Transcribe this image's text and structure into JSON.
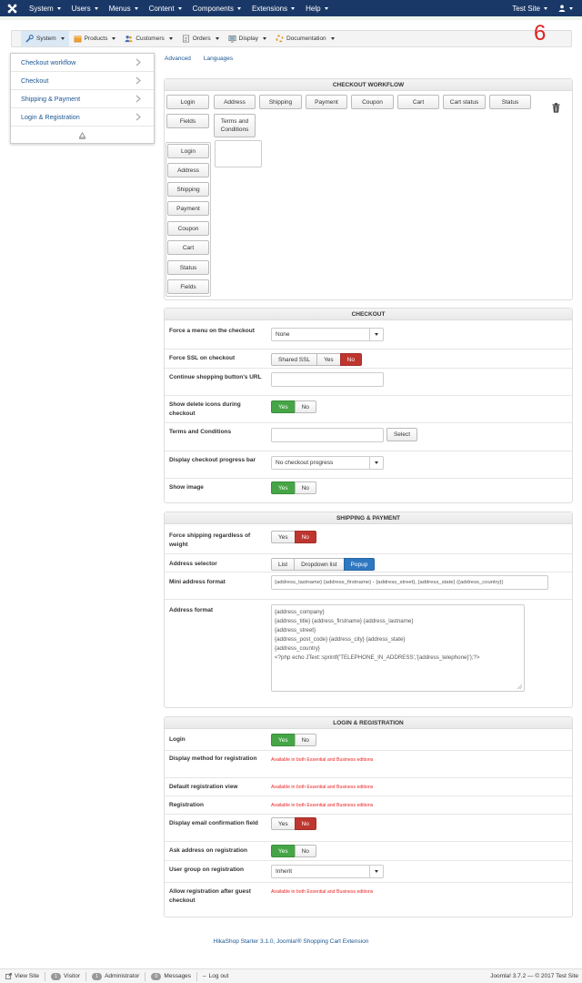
{
  "topbar": {
    "menus": [
      "System",
      "Users",
      "Menus",
      "Content",
      "Components",
      "Extensions",
      "Help"
    ],
    "site_link": "Test Site"
  },
  "hika_menu": {
    "items": [
      "System",
      "Products",
      "Customers",
      "Orders",
      "Display",
      "Documentation"
    ]
  },
  "corner_number": "6",
  "dropdown": {
    "items": [
      "Checkout workflow",
      "Checkout",
      "Shipping & Payment",
      "Login & Registration"
    ]
  },
  "sublinks": [
    "Advanced",
    "Languages"
  ],
  "workflow": {
    "title": "CHECKOUT WORKFLOW",
    "row1": [
      "Login",
      "Address",
      "Shipping",
      "Payment",
      "Coupon",
      "Cart",
      "Cart status",
      "Status",
      "Fields"
    ],
    "terms_line1": "Terms and",
    "terms_line2": "Conditions",
    "column": [
      "Login",
      "Address",
      "Shipping",
      "Payment",
      "Coupon",
      "Cart",
      "Status",
      "Fields"
    ]
  },
  "checkout": {
    "title": "CHECKOUT",
    "force_menu_label": "Force a menu on the checkout",
    "force_menu_value": "None",
    "force_ssl_label": "Force SSL on checkout",
    "force_ssl_options": [
      "Shared SSL",
      "Yes",
      "No"
    ],
    "continue_label": "Continue shopping button's URL",
    "show_delete_label": "Show delete icons during checkout",
    "terms_label": "Terms and Conditions",
    "select_btn": "Select",
    "progress_label": "Display checkout progress bar",
    "progress_value": "No checkout progress",
    "show_image_label": "Show image"
  },
  "yes": "Yes",
  "no": "No",
  "shipping": {
    "title": "SHIPPING & PAYMENT",
    "force_shipping_label": "Force shipping regardless of weight",
    "address_selector_label": "Address selector",
    "selector_options": [
      "List",
      "Dropdown list",
      "Popup"
    ],
    "mini_format_label": "Mini address format",
    "mini_format_value": "{address_lastname} {address_firstname} - {address_street}, {address_state} ({address_country})",
    "address_format_label": "Address format",
    "address_format_lines": [
      "{address_company}",
      "{address_title} {address_firstname} {address_lastname}",
      "{address_street}",
      "{address_post_code} {address_city} {address_state}",
      "{address_country}",
      "<?php echo JText::sprintf('TELEPHONE_IN_ADDRESS','{address_telephone}');?>"
    ]
  },
  "login": {
    "title": "LOGIN & REGISTRATION",
    "login_label": "Login",
    "display_method_label": "Display method for registration",
    "default_view_label": "Default registration view",
    "registration_label": "Registration",
    "email_confirm_label": "Display email confirmation field",
    "ask_address_label": "Ask address on registration",
    "user_group_label": "User group on registration",
    "user_group_value": "Inherit",
    "allow_guest_label": "Allow registration after guest checkout",
    "editions_note": "Available in both Essential and Business editions"
  },
  "footer": "HikaShop Starter 3.1.0, Joomla!® Shopping Cart Extension",
  "statusbar": {
    "view_site": "View Site",
    "visitor_count": "1",
    "visitor": "Visitor",
    "admin_count": "1",
    "admin": "Administrator",
    "messages_count": "0",
    "messages": "Messages",
    "logout": "Log out",
    "version": "Joomla! 3.7.2 — © 2017 Test Site"
  },
  "colors": {
    "topbar": "#1a3867",
    "link": "#1a5591",
    "yes_green": "#46a546",
    "no_red": "#bd362f",
    "popup_blue": "#2f78c1",
    "note_red": "#ee2222"
  }
}
